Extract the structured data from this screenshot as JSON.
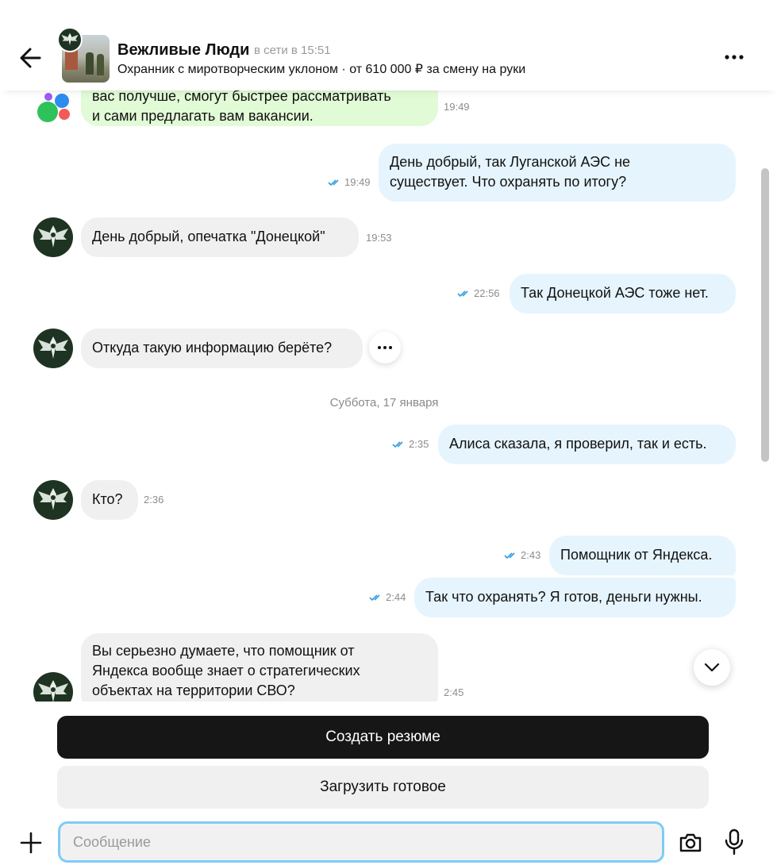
{
  "header": {
    "name": "Вежливые Люди",
    "status": "в сети в 15:51",
    "subtitle": "Охранник с миротворческим уклоном · от 610 000 ₽ за смену на руки"
  },
  "messages": [
    {
      "text": "вас получше, смогут быстрее рассматривать\nи сами предлагать вам вакансии.",
      "time": "19:49"
    },
    {
      "text": "День добрый, так Луганской АЭС не\nсуществует. Что охранять по итогу?",
      "time": "19:49"
    },
    {
      "text": "День добрый, опечатка \"Донецкой\"",
      "time": "19:53"
    },
    {
      "text": "Так Донецкой АЭС тоже нет.",
      "time": "22:56"
    },
    {
      "text": "Откуда такую информацию берёте?",
      "time": ""
    },
    {
      "text": "Алиса сказала, я проверил, так и есть.",
      "time": "2:35"
    },
    {
      "text": "Кто?",
      "time": "2:36"
    },
    {
      "text": "Помощник от Яндекса.",
      "time": "2:43"
    },
    {
      "text": "Так что охранять? Я готов, деньги нужны.",
      "time": "2:44"
    },
    {
      "text": "Вы серьезно думаете, что помощник от\nЯндекса вообще знает о стратегических\nобъектах на территории СВО?",
      "time": "2:45"
    }
  ],
  "date_separator": "Суббота, 17 января",
  "actions": {
    "create_resume": "Создать резюме",
    "upload_ready": "Загрузить готовое"
  },
  "composer": {
    "placeholder": "Сообщение"
  },
  "colors": {
    "incoming": "#f0f0f0",
    "outgoing": "#e6f4fd",
    "system": "#e2fbd7",
    "ticks": "#2f9be0",
    "primary_button": "#161616",
    "input_border": "#7ecbf7"
  }
}
